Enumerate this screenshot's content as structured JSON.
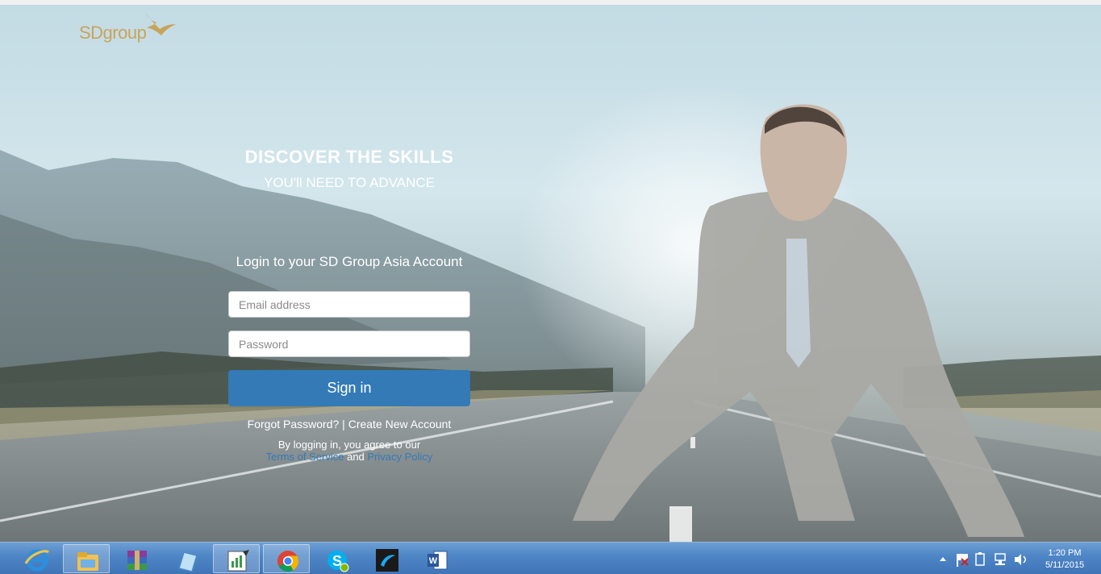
{
  "brand": {
    "logo_text": "SDgroup"
  },
  "hero": {
    "title": "DISCOVER THE SKILLS",
    "subtitle": "YOU'll NEED TO ADVANCE"
  },
  "login": {
    "heading": "Login to your SD Group Asia Account",
    "email_placeholder": "Email address",
    "password_placeholder": "Password",
    "signin_label": "Sign in",
    "forgot_label": "Forgot Password?",
    "separator": " | ",
    "create_label": "Create New Account",
    "agree_text": "By logging in, you agree to our",
    "terms_label": "Terms of Service",
    "and_text": " and ",
    "privacy_label": "Privacy Policy"
  },
  "taskbar": {
    "apps": [
      {
        "name": "internet-explorer-icon",
        "active": false
      },
      {
        "name": "file-explorer-icon",
        "active": true
      },
      {
        "name": "winrar-icon",
        "active": false
      },
      {
        "name": "notepad-icon",
        "active": false
      },
      {
        "name": "chart-app-icon",
        "active": true
      },
      {
        "name": "chrome-icon",
        "active": true
      },
      {
        "name": "skype-icon",
        "active": false
      },
      {
        "name": "telenor-icon",
        "active": false
      },
      {
        "name": "word-icon",
        "active": false
      }
    ],
    "clock_time": "1:20 PM",
    "clock_date": "5/11/2015"
  },
  "colors": {
    "primary": "#337ab7",
    "logo_gold": "#c8a45a",
    "taskbar": "#4f86c6"
  }
}
